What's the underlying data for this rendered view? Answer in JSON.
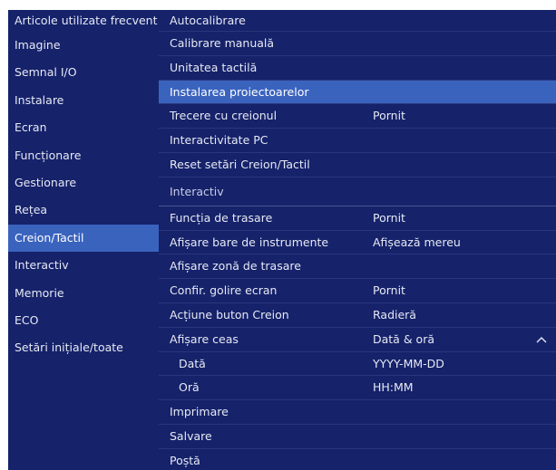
{
  "sidebar": {
    "items": [
      {
        "label": "Articole utilizate frecvent"
      },
      {
        "label": "Imagine"
      },
      {
        "label": "Semnal I/O"
      },
      {
        "label": "Instalare"
      },
      {
        "label": "Ecran"
      },
      {
        "label": "Funcționare"
      },
      {
        "label": "Gestionare"
      },
      {
        "label": "Rețea"
      },
      {
        "label": "Creion/Tactil",
        "selected": true
      },
      {
        "label": "Interactiv"
      },
      {
        "label": "Memorie"
      },
      {
        "label": "ECO"
      },
      {
        "label": "Setări inițiale/toate"
      }
    ]
  },
  "main": {
    "top_items": [
      {
        "label": "Autocalibrare",
        "value": ""
      },
      {
        "label": "Calibrare manuală",
        "value": ""
      },
      {
        "label": "Unitatea tactilă",
        "value": ""
      },
      {
        "label": "Instalarea proiectoarelor",
        "value": "",
        "selected": true
      },
      {
        "label": "Trecere cu creionul",
        "value": "Pornit"
      },
      {
        "label": "Interactivitate PC",
        "value": ""
      },
      {
        "label": "Reset setări Creion/Tactil",
        "value": ""
      }
    ],
    "section_header": "Interactiv",
    "section_items": [
      {
        "label": "Funcția de trasare",
        "value": "Pornit"
      },
      {
        "label": "Afișare bare de instrumente",
        "value": "Afișează mereu"
      },
      {
        "label": "Afișare zonă de trasare",
        "value": ""
      },
      {
        "label": "Confir. golire ecran",
        "value": "Pornit"
      },
      {
        "label": "Acțiune buton Creion",
        "value": "Radieră"
      },
      {
        "label": "Afișare ceas",
        "value": "Dată & oră",
        "expanded": true
      },
      {
        "label": "Dată",
        "value": "YYYY-MM-DD",
        "sub": true
      },
      {
        "label": "Oră",
        "value": "HH:MM",
        "sub": true
      },
      {
        "label": "Imprimare",
        "value": ""
      },
      {
        "label": "Salvare",
        "value": ""
      },
      {
        "label": "Poștă",
        "value": ""
      }
    ],
    "expand_icon": "chevron-up-icon"
  },
  "colors": {
    "background": "#16226a",
    "selected": "#3a63be",
    "text": "#e6e9f4",
    "divider": "#2a377c"
  }
}
